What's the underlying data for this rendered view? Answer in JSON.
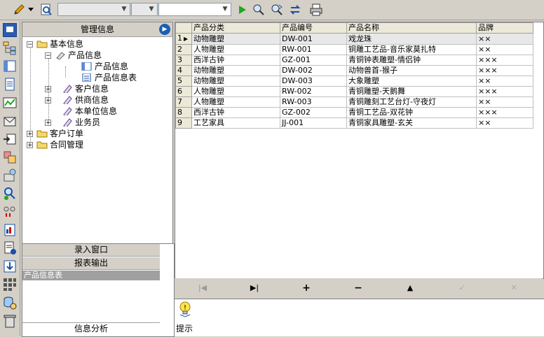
{
  "toolbar": {
    "combo1_value": "",
    "combo2_value": "",
    "combo3_value": "",
    "icons": [
      "pencil-icon",
      "dropdown-icon",
      "preview-icon",
      "run-icon",
      "find-icon",
      "find-next-icon",
      "refresh-icon",
      "print-icon"
    ]
  },
  "tree": {
    "header": "管理信息",
    "nodes": {
      "basic": "基本信息",
      "product": "产品信息",
      "product_info": "产品信息",
      "product_table": "产品信息表",
      "customer": "客户信息",
      "supplier": "供商信息",
      "unit": "本单位信息",
      "salesman": "业务员",
      "orders": "客户订单",
      "contracts": "合同管理"
    }
  },
  "left_sections": {
    "entry": "录入窗口",
    "report": "报表输出",
    "selected_item": "产品信息表",
    "analysis": "信息分析"
  },
  "grid": {
    "columns": [
      "产品分类",
      "产品编号",
      "产品名称",
      "品牌"
    ],
    "rows": [
      {
        "no": "1",
        "cat": "动物雕塑",
        "code": "DW-001",
        "name": "戏龙珠",
        "brand": "××"
      },
      {
        "no": "2",
        "cat": "人物雕塑",
        "code": "RW-001",
        "name": "铜雕工艺品-音乐家莫扎特",
        "brand": "××"
      },
      {
        "no": "3",
        "cat": "西洋古钟",
        "code": "GZ-001",
        "name": "青铜钟表雕塑-情侣钟",
        "brand": "×××"
      },
      {
        "no": "4",
        "cat": "动物雕塑",
        "code": "DW-002",
        "name": "动物兽首-猴子",
        "brand": "×××"
      },
      {
        "no": "5",
        "cat": "动物雕塑",
        "code": "DW-003",
        "name": "大象雕塑",
        "brand": "××"
      },
      {
        "no": "6",
        "cat": "人物雕塑",
        "code": "RW-002",
        "name": "青铜雕塑-天鹅舞",
        "brand": "×××"
      },
      {
        "no": "7",
        "cat": "人物雕塑",
        "code": "RW-003",
        "name": "青铜雕刻工艺台灯-守夜灯",
        "brand": "××"
      },
      {
        "no": "8",
        "cat": "西洋古钟",
        "code": "GZ-002",
        "name": "青铜工艺品-双花钟",
        "brand": "×××"
      },
      {
        "no": "9",
        "cat": "工艺家具",
        "code": "JJ-001",
        "name": "青铜家具雕塑-玄关",
        "brand": "××"
      }
    ]
  },
  "navigator": {
    "first": "|◀",
    "last": "▶|",
    "insert": "+",
    "delete": "−",
    "edit": "▲",
    "post": "✓",
    "cancel": "✕"
  },
  "hint": {
    "label": "提示"
  }
}
